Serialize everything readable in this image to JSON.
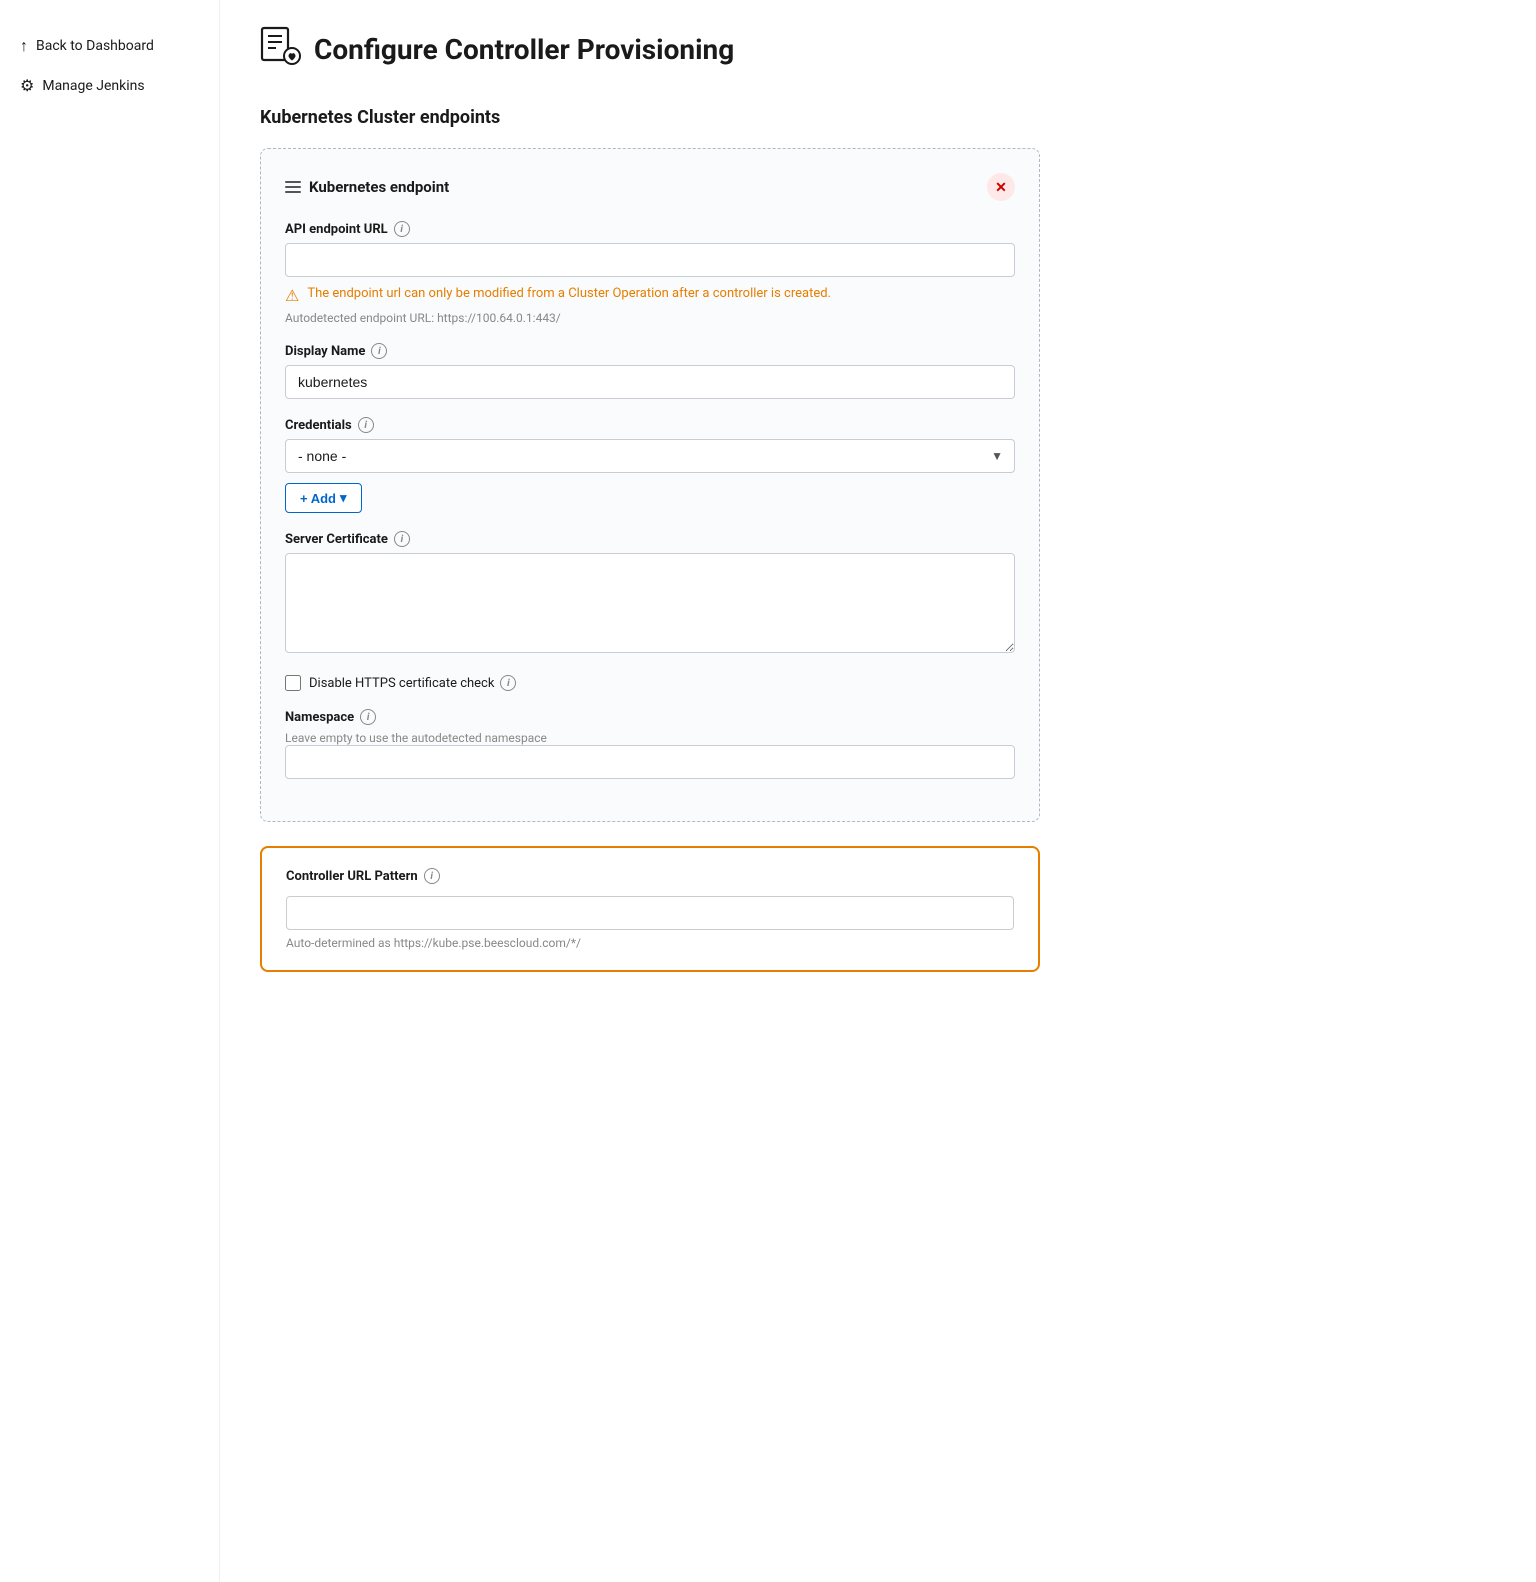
{
  "sidebar": {
    "back_label": "Back to Dashboard",
    "manage_label": "Manage Jenkins"
  },
  "page": {
    "title": "Configure Controller Provisioning"
  },
  "section": {
    "title": "Kubernetes Cluster endpoints"
  },
  "endpoint_card": {
    "title": "Kubernetes endpoint",
    "api_endpoint_label": "API endpoint URL",
    "warning_text": "The endpoint url can only be modified from a Cluster Operation after a controller is created.",
    "autodetect_text": "Autodetected endpoint URL: https://100.64.0.1:443/",
    "display_name_label": "Display Name",
    "display_name_value": "kubernetes",
    "credentials_label": "Credentials",
    "credentials_value": "- none -",
    "add_button_label": "+ Add",
    "server_cert_label": "Server Certificate",
    "disable_https_label": "Disable HTTPS certificate check",
    "namespace_label": "Namespace",
    "namespace_hint": "Leave empty to use the autodetected namespace"
  },
  "controller_url_card": {
    "label": "Controller URL Pattern",
    "auto_text": "Auto-determined as https://kube.pse.beescloud.com/*/"
  }
}
